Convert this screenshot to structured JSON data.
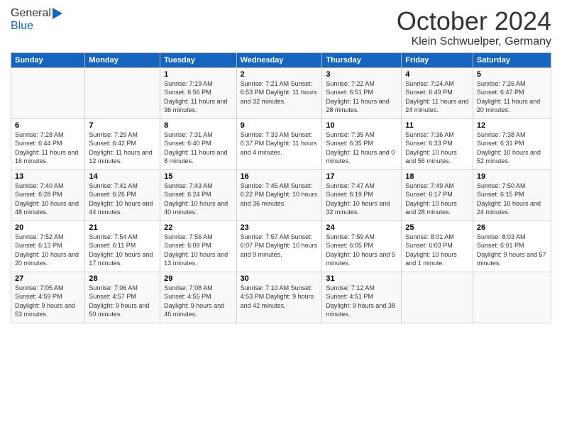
{
  "logo": {
    "general": "General",
    "blue": "Blue"
  },
  "header": {
    "month": "October 2024",
    "location": "Klein Schwuelper, Germany"
  },
  "days_of_week": [
    "Sunday",
    "Monday",
    "Tuesday",
    "Wednesday",
    "Thursday",
    "Friday",
    "Saturday"
  ],
  "weeks": [
    [
      {
        "day": "",
        "info": ""
      },
      {
        "day": "",
        "info": ""
      },
      {
        "day": "1",
        "info": "Sunrise: 7:19 AM\nSunset: 6:56 PM\nDaylight: 11 hours\nand 36 minutes."
      },
      {
        "day": "2",
        "info": "Sunrise: 7:21 AM\nSunset: 6:53 PM\nDaylight: 11 hours\nand 32 minutes."
      },
      {
        "day": "3",
        "info": "Sunrise: 7:22 AM\nSunset: 6:51 PM\nDaylight: 11 hours\nand 28 minutes."
      },
      {
        "day": "4",
        "info": "Sunrise: 7:24 AM\nSunset: 6:49 PM\nDaylight: 11 hours\nand 24 minutes."
      },
      {
        "day": "5",
        "info": "Sunrise: 7:26 AM\nSunset: 6:47 PM\nDaylight: 11 hours\nand 20 minutes."
      }
    ],
    [
      {
        "day": "6",
        "info": "Sunrise: 7:28 AM\nSunset: 6:44 PM\nDaylight: 11 hours\nand 16 minutes."
      },
      {
        "day": "7",
        "info": "Sunrise: 7:29 AM\nSunset: 6:42 PM\nDaylight: 11 hours\nand 12 minutes."
      },
      {
        "day": "8",
        "info": "Sunrise: 7:31 AM\nSunset: 6:40 PM\nDaylight: 11 hours\nand 8 minutes."
      },
      {
        "day": "9",
        "info": "Sunrise: 7:33 AM\nSunset: 6:37 PM\nDaylight: 11 hours\nand 4 minutes."
      },
      {
        "day": "10",
        "info": "Sunrise: 7:35 AM\nSunset: 6:35 PM\nDaylight: 11 hours\nand 0 minutes."
      },
      {
        "day": "11",
        "info": "Sunrise: 7:36 AM\nSunset: 6:33 PM\nDaylight: 10 hours\nand 56 minutes."
      },
      {
        "day": "12",
        "info": "Sunrise: 7:38 AM\nSunset: 6:31 PM\nDaylight: 10 hours\nand 52 minutes."
      }
    ],
    [
      {
        "day": "13",
        "info": "Sunrise: 7:40 AM\nSunset: 6:28 PM\nDaylight: 10 hours\nand 48 minutes."
      },
      {
        "day": "14",
        "info": "Sunrise: 7:41 AM\nSunset: 6:26 PM\nDaylight: 10 hours\nand 44 minutes."
      },
      {
        "day": "15",
        "info": "Sunrise: 7:43 AM\nSunset: 6:24 PM\nDaylight: 10 hours\nand 40 minutes."
      },
      {
        "day": "16",
        "info": "Sunrise: 7:45 AM\nSunset: 6:22 PM\nDaylight: 10 hours\nand 36 minutes."
      },
      {
        "day": "17",
        "info": "Sunrise: 7:47 AM\nSunset: 6:19 PM\nDaylight: 10 hours\nand 32 minutes."
      },
      {
        "day": "18",
        "info": "Sunrise: 7:49 AM\nSunset: 6:17 PM\nDaylight: 10 hours\nand 28 minutes."
      },
      {
        "day": "19",
        "info": "Sunrise: 7:50 AM\nSunset: 6:15 PM\nDaylight: 10 hours\nand 24 minutes."
      }
    ],
    [
      {
        "day": "20",
        "info": "Sunrise: 7:52 AM\nSunset: 6:13 PM\nDaylight: 10 hours\nand 20 minutes."
      },
      {
        "day": "21",
        "info": "Sunrise: 7:54 AM\nSunset: 6:11 PM\nDaylight: 10 hours\nand 17 minutes."
      },
      {
        "day": "22",
        "info": "Sunrise: 7:56 AM\nSunset: 6:09 PM\nDaylight: 10 hours\nand 13 minutes."
      },
      {
        "day": "23",
        "info": "Sunrise: 7:57 AM\nSunset: 6:07 PM\nDaylight: 10 hours\nand 9 minutes."
      },
      {
        "day": "24",
        "info": "Sunrise: 7:59 AM\nSunset: 6:05 PM\nDaylight: 10 hours\nand 5 minutes."
      },
      {
        "day": "25",
        "info": "Sunrise: 8:01 AM\nSunset: 6:03 PM\nDaylight: 10 hours\nand 1 minute."
      },
      {
        "day": "26",
        "info": "Sunrise: 8:03 AM\nSunset: 6:01 PM\nDaylight: 9 hours\nand 57 minutes."
      }
    ],
    [
      {
        "day": "27",
        "info": "Sunrise: 7:05 AM\nSunset: 4:59 PM\nDaylight: 9 hours\nand 53 minutes."
      },
      {
        "day": "28",
        "info": "Sunrise: 7:06 AM\nSunset: 4:57 PM\nDaylight: 9 hours\nand 50 minutes."
      },
      {
        "day": "29",
        "info": "Sunrise: 7:08 AM\nSunset: 4:55 PM\nDaylight: 9 hours\nand 46 minutes."
      },
      {
        "day": "30",
        "info": "Sunrise: 7:10 AM\nSunset: 4:53 PM\nDaylight: 9 hours\nand 42 minutes."
      },
      {
        "day": "31",
        "info": "Sunrise: 7:12 AM\nSunset: 4:51 PM\nDaylight: 9 hours\nand 38 minutes."
      },
      {
        "day": "",
        "info": ""
      },
      {
        "day": "",
        "info": ""
      }
    ]
  ]
}
